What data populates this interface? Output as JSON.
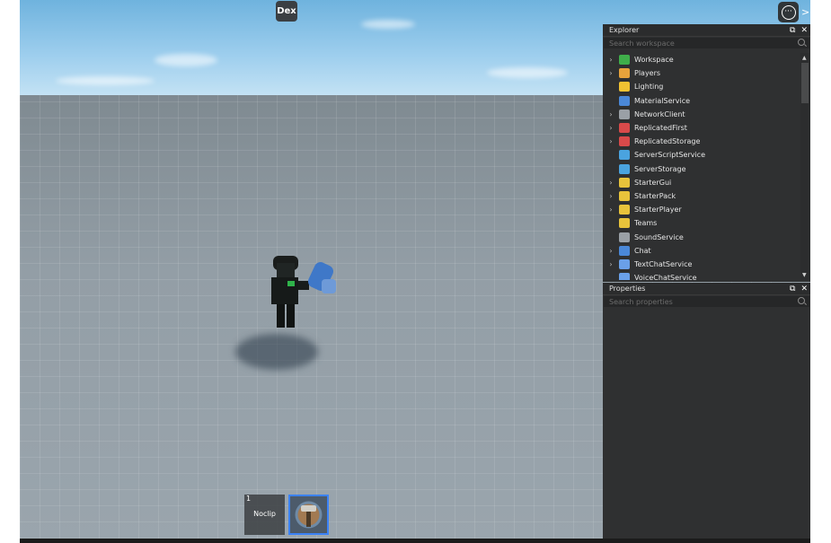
{
  "top_bar": {
    "dex_label": "Dex",
    "menu_icon": "ellipsis-circle-icon",
    "side_arrow": ">"
  },
  "hotbar": [
    {
      "number": "1",
      "label": "Noclip",
      "selected": false
    },
    {
      "number": "",
      "label": "",
      "icon": "hammer-tool-icon",
      "selected": true
    }
  ],
  "explorer": {
    "title": "Explorer",
    "search_placeholder": "Search workspace",
    "items": [
      {
        "name": "Workspace",
        "expandable": true,
        "icon": "globe-icon",
        "color": "#3fae4a"
      },
      {
        "name": "Players",
        "expandable": true,
        "icon": "players-icon",
        "color": "#e8a33b"
      },
      {
        "name": "Lighting",
        "expandable": false,
        "icon": "lightbulb-icon",
        "color": "#f1c232"
      },
      {
        "name": "MaterialService",
        "expandable": false,
        "icon": "material-icon",
        "color": "#4a88d8"
      },
      {
        "name": "NetworkClient",
        "expandable": true,
        "icon": "network-icon",
        "color": "#9aa0a6"
      },
      {
        "name": "ReplicatedFirst",
        "expandable": true,
        "icon": "replicated-first-icon",
        "color": "#d84a4a"
      },
      {
        "name": "ReplicatedStorage",
        "expandable": true,
        "icon": "replicated-storage-icon",
        "color": "#d84a4a"
      },
      {
        "name": "ServerScriptService",
        "expandable": false,
        "icon": "server-script-icon",
        "color": "#4aa3df"
      },
      {
        "name": "ServerStorage",
        "expandable": false,
        "icon": "server-storage-icon",
        "color": "#4aa3df"
      },
      {
        "name": "StarterGui",
        "expandable": true,
        "icon": "starter-gui-icon",
        "color": "#e8c33b"
      },
      {
        "name": "StarterPack",
        "expandable": true,
        "icon": "starter-pack-icon",
        "color": "#e8c33b"
      },
      {
        "name": "StarterPlayer",
        "expandable": true,
        "icon": "starter-player-icon",
        "color": "#e8c33b"
      },
      {
        "name": "Teams",
        "expandable": false,
        "icon": "teams-icon",
        "color": "#e8c33b"
      },
      {
        "name": "SoundService",
        "expandable": false,
        "icon": "sound-icon",
        "color": "#9aa0a6"
      },
      {
        "name": "Chat",
        "expandable": true,
        "icon": "chat-icon",
        "color": "#4a88d8"
      },
      {
        "name": "TextChatService",
        "expandable": true,
        "icon": "text-chat-icon",
        "color": "#6aa0e8"
      },
      {
        "name": "VoiceChatService",
        "expandable": false,
        "icon": "voice-chat-icon",
        "color": "#6aa0e8"
      }
    ]
  },
  "properties": {
    "title": "Properties",
    "search_placeholder": "Search properties"
  },
  "panel_controls": {
    "undock": "⧉",
    "close": "✕"
  }
}
